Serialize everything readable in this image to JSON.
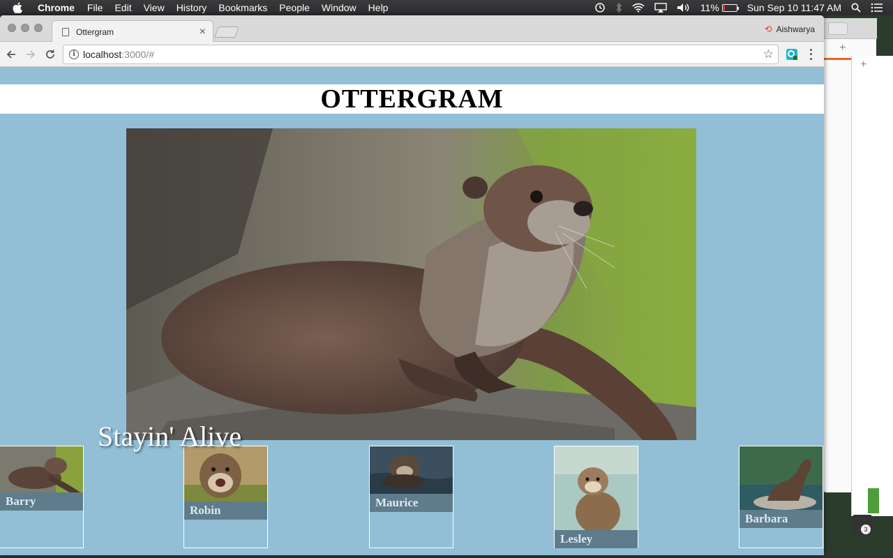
{
  "menubar": {
    "app_name": "Chrome",
    "items": [
      "File",
      "Edit",
      "View",
      "History",
      "Bookmarks",
      "People",
      "Window",
      "Help"
    ],
    "battery_percent": "11%",
    "battery_level": 0.11,
    "datetime": "Sun Sep 10  11:47 AM"
  },
  "browser": {
    "tab_title": "Ottergram",
    "profile_name": "Aishwarya",
    "url_host": "localhost",
    "url_path": ":3000/#"
  },
  "page": {
    "heading": "OTTERGRAM",
    "detail_title": "Stayin' Alive",
    "thumbnails": [
      {
        "name": "Barry"
      },
      {
        "name": "Robin"
      },
      {
        "name": "Maurice"
      },
      {
        "name": "Lesley"
      },
      {
        "name": "Barbara"
      }
    ]
  },
  "colors": {
    "page_background": "#92bfd6",
    "thumbnail_label_bg": "#5e7c8b",
    "header_background": "#ffffff"
  },
  "icons": [
    "apple-icon",
    "history-icon",
    "bluetooth-icon",
    "wifi-icon",
    "airplay-icon",
    "volume-icon",
    "battery-icon",
    "search-icon",
    "list-icon",
    "page-icon",
    "close-icon",
    "back-icon",
    "forward-icon",
    "reload-icon",
    "info-icon",
    "star-icon",
    "extension-icon",
    "menu-icon"
  ]
}
